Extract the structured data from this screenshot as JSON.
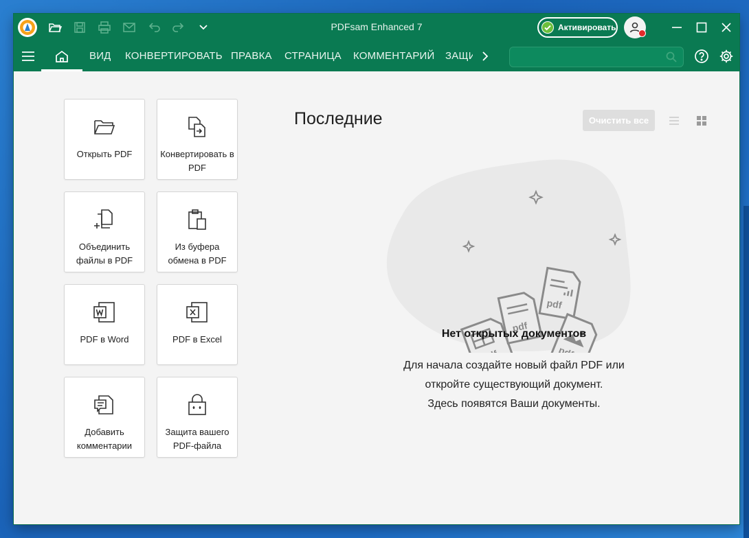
{
  "window": {
    "title": "PDFsam Enhanced 7",
    "activate_label": "Активировать"
  },
  "menu": {
    "items": [
      "ВИД",
      "КОНВЕРТИРОВАТЬ",
      "ПРАВКА",
      "СТРАНИЦА",
      "КОММЕНТАРИЙ",
      "ЗАЩИ"
    ],
    "search_placeholder": ""
  },
  "tiles": [
    {
      "label": "Открыть PDF",
      "icon": "folder-open-icon"
    },
    {
      "label": "Конвертировать в PDF",
      "icon": "convert-icon"
    },
    {
      "label": "Объединить файлы в PDF",
      "icon": "merge-icon"
    },
    {
      "label": "Из буфера обмена в PDF",
      "icon": "clipboard-icon"
    },
    {
      "label": "PDF в Word",
      "icon": "word-icon"
    },
    {
      "label": "PDF в Excel",
      "icon": "excel-icon"
    },
    {
      "label": "Добавить комментарии",
      "icon": "comment-icon"
    },
    {
      "label": "Защита вашего PDF-файла",
      "icon": "lock-icon"
    }
  ],
  "recent": {
    "title": "Последние",
    "clear_all": "Очистить все",
    "empty_title": "Нет открытых документов",
    "empty_lines": [
      "Для начала создайте новый файл PDF или",
      "откройте существующий документ.",
      "Здесь появятся Ваши документы."
    ],
    "illustration_labels": [
      "pdf",
      "pdf",
      "pdf",
      "pdf"
    ]
  },
  "colors": {
    "brand": "#0a7a52",
    "background": "#f4f4f4"
  }
}
